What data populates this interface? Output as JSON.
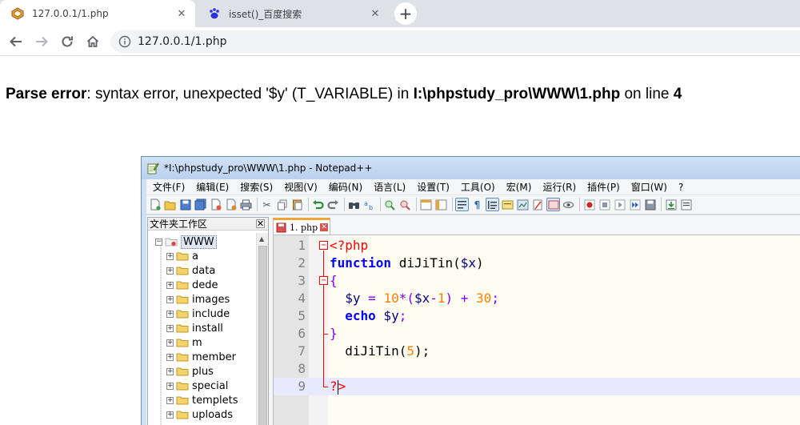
{
  "browser": {
    "tabs": [
      {
        "title": "127.0.0.1/1.php",
        "active": true,
        "favicon": "php-server-icon"
      },
      {
        "title": "isset()_百度搜索",
        "active": false,
        "favicon": "baidu-paw-icon"
      }
    ],
    "new_tab_label": "+",
    "address": "127.0.0.1/1.php"
  },
  "page": {
    "error_label": "Parse error",
    "error_message": ": syntax error, unexpected '$y' (T_VARIABLE) in ",
    "error_file": "I:\\phpstudy_pro\\WWW\\1.php",
    "on_line_text": " on line ",
    "line_number": "4"
  },
  "notepad": {
    "title": "*I:\\phpstudy_pro\\WWW\\1.php - Notepad++",
    "menu": [
      "文件(F)",
      "编辑(E)",
      "搜索(S)",
      "视图(V)",
      "编码(N)",
      "语言(L)",
      "设置(T)",
      "工具(O)",
      "宏(M)",
      "运行(R)",
      "插件(P)",
      "窗口(W)",
      "?"
    ],
    "panel_title": "文件夹工作区",
    "tree_root": "WWW",
    "tree_items": [
      "a",
      "data",
      "dede",
      "images",
      "include",
      "install",
      "m",
      "member",
      "plus",
      "special",
      "templets",
      "uploads"
    ],
    "tab_label": "1. php",
    "line_numbers": [
      "1",
      "2",
      "3",
      "4",
      "5",
      "6",
      "7",
      "8",
      "9"
    ],
    "code": {
      "l1": "<?php",
      "l2_kw": "function",
      "l2_name": " diJiTin(",
      "l2_var": "$x",
      "l2_close": ")",
      "l3": "{",
      "l4_var": "$y",
      "l4_eq": " = ",
      "l4_num1": "10",
      "l4_mul": "*(",
      "l4_var2": "$x",
      "l4_minus": "-",
      "l4_num2": "1",
      "l4_paren": ") + ",
      "l4_num3": "30",
      "l4_semi": ";",
      "l5_kw": "echo",
      "l5_var": " $y",
      "l5_semi": ";",
      "l6": "}",
      "l7_name": "diJiTin(",
      "l7_num": "5",
      "l7_close": ");",
      "l9_q": "?",
      "l9_gt": ">"
    },
    "colors": {
      "keyword": "#0000ff",
      "variable": "#000080",
      "number": "#ff8000",
      "operator": "#8000ff",
      "php_tag": "#ff0000",
      "current_line": "#e8e8ff",
      "tab_accent": "#f2a33a"
    }
  }
}
